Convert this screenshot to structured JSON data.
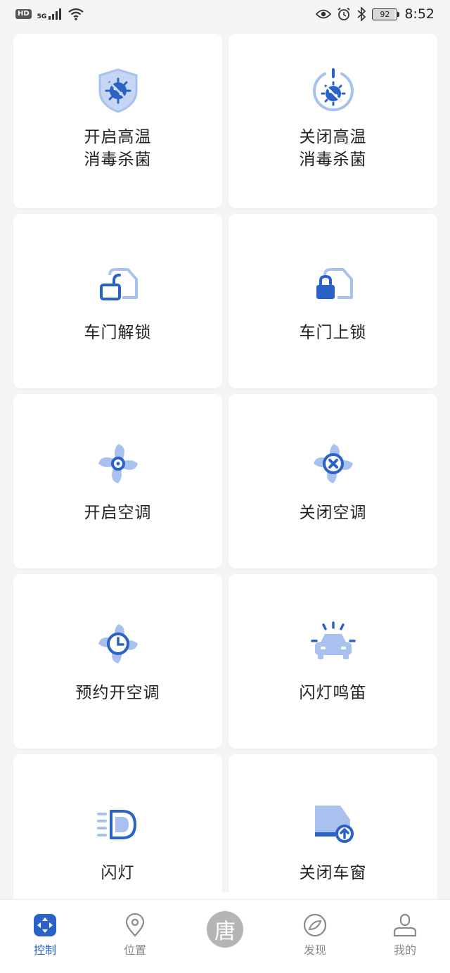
{
  "status_bar": {
    "hd": "HD",
    "network": "5G",
    "battery": "92",
    "time": "8:52"
  },
  "colors": {
    "primary": "#2a62c7",
    "light": "#a9c1ee",
    "inactive": "#8a8a8a"
  },
  "controls": [
    {
      "label": "开启高温\n消毒杀菌",
      "icon": "shield-virus-icon"
    },
    {
      "label": "关闭高温\n消毒杀菌",
      "icon": "power-virus-icon"
    },
    {
      "label": "车门解锁",
      "icon": "door-unlock-icon"
    },
    {
      "label": "车门上锁",
      "icon": "door-lock-icon"
    },
    {
      "label": "开启空调",
      "icon": "fan-on-icon"
    },
    {
      "label": "关闭空调",
      "icon": "fan-off-icon"
    },
    {
      "label": "预约开空调",
      "icon": "fan-schedule-icon"
    },
    {
      "label": "闪灯鸣笛",
      "icon": "car-flash-horn-icon"
    },
    {
      "label": "闪灯",
      "icon": "headlight-icon"
    },
    {
      "label": "关闭车窗",
      "icon": "window-close-icon"
    }
  ],
  "nav": {
    "items": [
      {
        "label": "控制",
        "icon": "control-icon",
        "active": true
      },
      {
        "label": "位置",
        "icon": "location-pin-icon",
        "active": false
      },
      {
        "label": "唐",
        "icon": "brand-logo-icon",
        "active": false
      },
      {
        "label": "发现",
        "icon": "compass-icon",
        "active": false
      },
      {
        "label": "我的",
        "icon": "person-icon",
        "active": false
      }
    ]
  }
}
